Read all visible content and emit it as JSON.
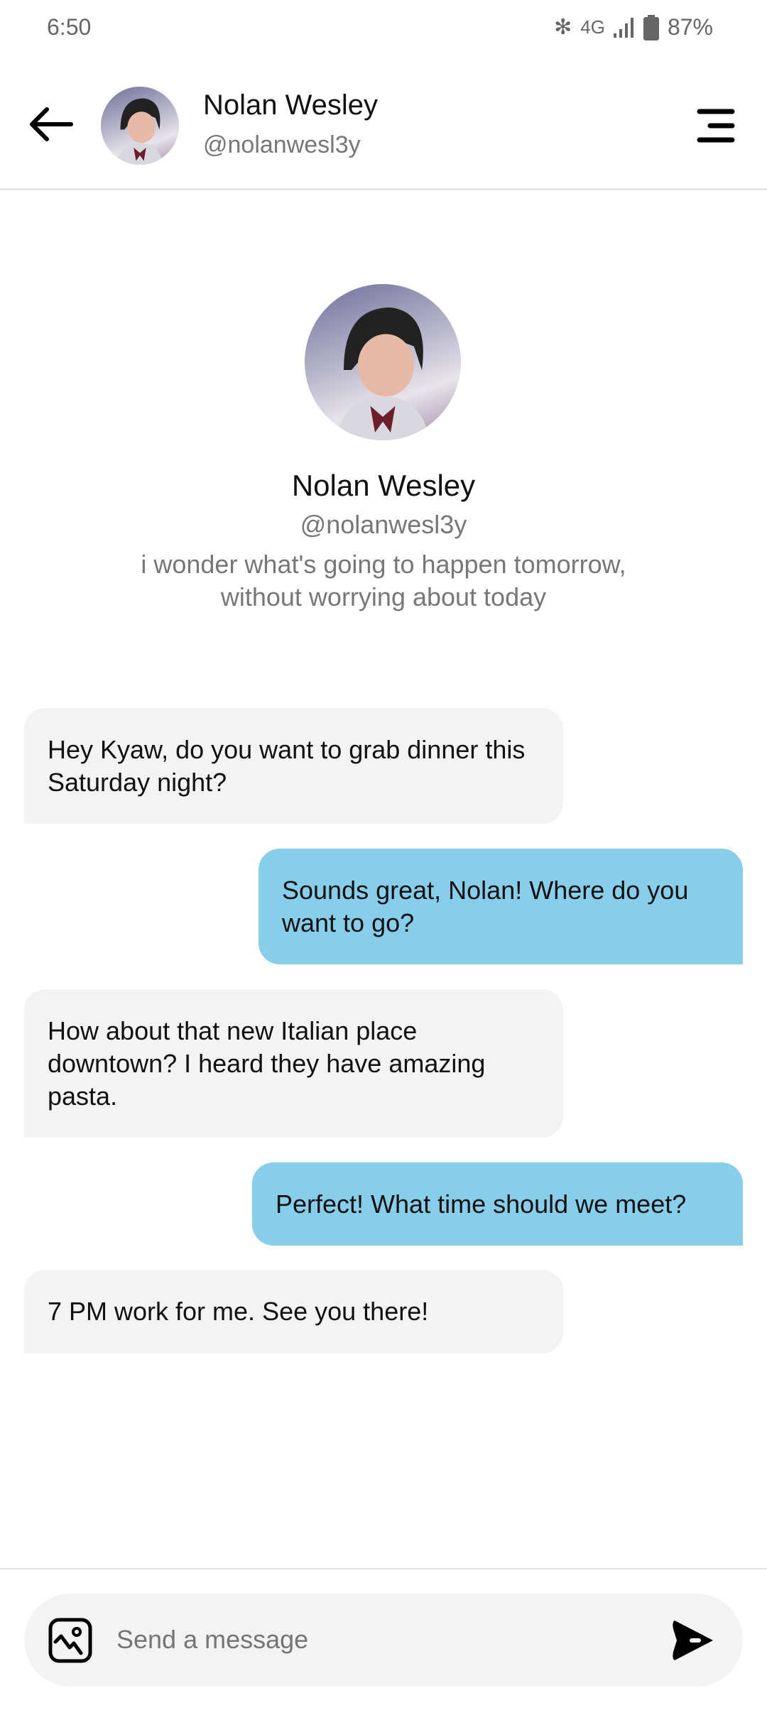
{
  "status_bar": {
    "time": "6:50",
    "network": "4G",
    "battery": "87%"
  },
  "header": {
    "name": "Nolan Wesley",
    "handle": "@nolanwesl3y"
  },
  "profile": {
    "name": "Nolan Wesley",
    "handle": "@nolanwesl3y",
    "bio_line1": "i wonder what's going to happen tomorrow,",
    "bio_line2": "without worrying about today"
  },
  "messages": [
    {
      "from": "them",
      "text": "Hey Kyaw, do you want to grab dinner this Saturday night?"
    },
    {
      "from": "me",
      "text": "Sounds great, Nolan! Where do you want to go?"
    },
    {
      "from": "them",
      "text": "How about that new Italian place downtown? I heard they have amazing pasta."
    },
    {
      "from": "me",
      "text": "Perfect! What time should we meet?"
    },
    {
      "from": "them",
      "text": "7 PM work for me. See you there!"
    }
  ],
  "composer": {
    "placeholder": "Send a message"
  },
  "colors": {
    "outgoing": "#87ceeb",
    "incoming": "#f3f3f3"
  }
}
